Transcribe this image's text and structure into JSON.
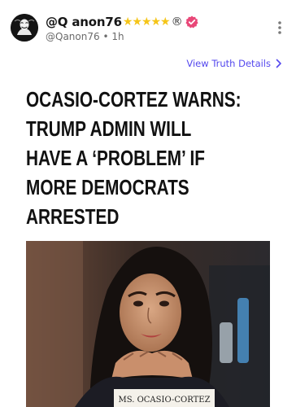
{
  "post": {
    "display_name": "@Q anon76",
    "stars": "★★★★★",
    "registered_mark": "®",
    "handle": "@Qanon76",
    "separator": "•",
    "time_ago": "1h",
    "truth_details_link": "View Truth Details",
    "headline_lines": [
      "OCASIO-CORTEZ WARNS:",
      "TRUMP ADMIN WILL",
      "HAVE A ‘PROBLEM’ IF",
      "MORE DEMOCRATS",
      "ARRESTED"
    ],
    "nameplate_text": "MS. OCASIO-CORTEZ"
  },
  "colors": {
    "link": "#5448ee",
    "star": "#f5c518",
    "verified_badge": "#e94778",
    "headline": "#111111"
  },
  "icons": {
    "avatar": "anonymous-mask-icon",
    "verified": "verified-badge-icon",
    "more": "vertical-ellipsis-icon",
    "link_arrow": "chevron-right-icon"
  }
}
